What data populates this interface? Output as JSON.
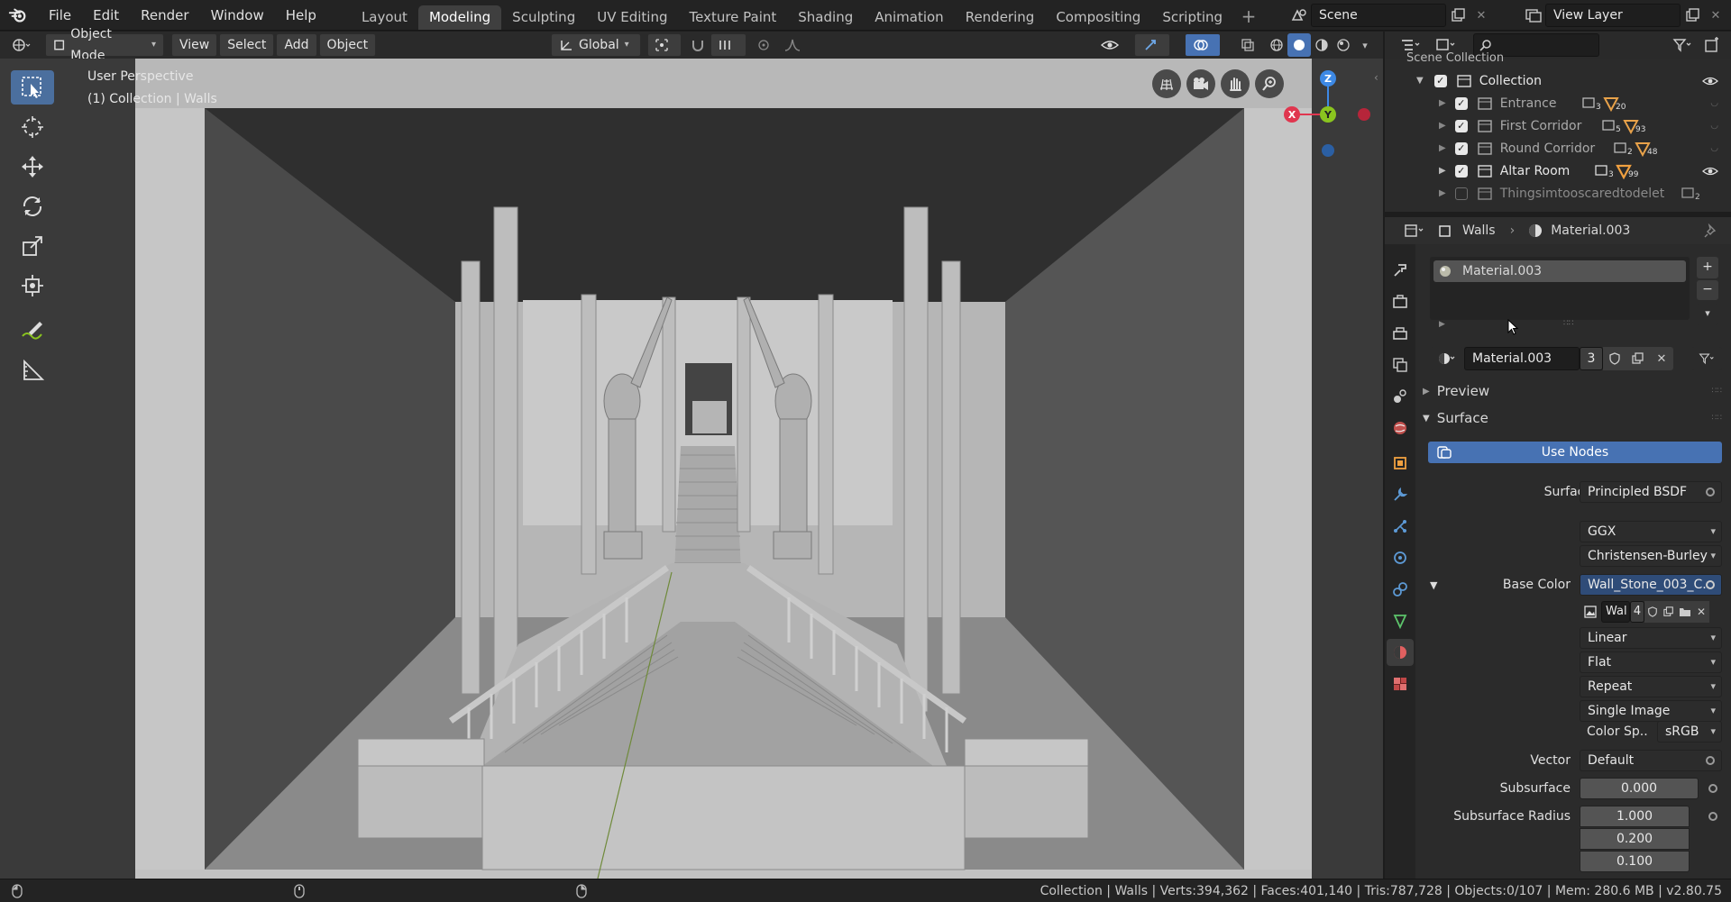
{
  "menu": [
    "File",
    "Edit",
    "Render",
    "Window",
    "Help"
  ],
  "workspaces": [
    {
      "label": "Layout",
      "active": false
    },
    {
      "label": "Modeling",
      "active": true
    },
    {
      "label": "Sculpting",
      "active": false
    },
    {
      "label": "UV Editing",
      "active": false
    },
    {
      "label": "Texture Paint",
      "active": false
    },
    {
      "label": "Shading",
      "active": false
    },
    {
      "label": "Animation",
      "active": false
    },
    {
      "label": "Rendering",
      "active": false
    },
    {
      "label": "Compositing",
      "active": false
    },
    {
      "label": "Scripting",
      "active": false
    }
  ],
  "scene": "Scene",
  "view_layer": "View Layer",
  "viewport_header": {
    "mode": "Object Mode",
    "view": "View",
    "select": "Select",
    "add": "Add",
    "object": "Object",
    "orientation": "Global"
  },
  "viewport": {
    "perspective": "User Perspective",
    "collection_info": "(1) Collection | Walls",
    "axes": {
      "z": "Z",
      "y": "Y",
      "x": "X"
    }
  },
  "outliner": {
    "search_placeholder": "",
    "top_item": "Scene Collection",
    "collection": "Collection",
    "items": [
      {
        "name": "Entrance",
        "count_a": "3",
        "count_b": "20",
        "enabled": true
      },
      {
        "name": "First Corridor",
        "count_a": "5",
        "count_b": "93",
        "enabled": true
      },
      {
        "name": "Round Corridor",
        "count_a": "2",
        "count_b": "48",
        "enabled": true
      },
      {
        "name": "Altar Room",
        "count_a": "3",
        "count_b": "99",
        "enabled": true
      },
      {
        "name": "Thingsimtooscaredtodelet",
        "count_a": "2",
        "count_b": "",
        "enabled": false
      }
    ]
  },
  "properties": {
    "breadcrumb_object": "Walls",
    "breadcrumb_material": "Material.003",
    "slot_name": "Material.003",
    "material_name": "Material.003",
    "material_users": "3",
    "preview": "Preview",
    "surface_section": "Surface",
    "use_nodes": "Use Nodes",
    "surface_label": "Surface",
    "surface_value": "Principled BSDF",
    "distribution": "GGX",
    "subsurface_method": "Christensen-Burley",
    "base_color_label": "Base Color",
    "base_color_value": "Wall_Stone_003_C..",
    "image_name": "Wal",
    "image_users": "4",
    "interpolation": "Linear",
    "projection": "Flat",
    "extension": "Repeat",
    "source": "Single Image",
    "color_space_label": "Color Sp..",
    "color_space_value": "sRGB",
    "vector_label": "Vector",
    "vector_value": "Default",
    "subsurface_label": "Subsurface",
    "subsurface_value": "0.000",
    "subsurface_radius_label": "Subsurface Radius",
    "subsurface_radius": [
      "1.000",
      "0.200",
      "0.100"
    ]
  },
  "status": "Collection | Walls | Verts:394,362 | Faces:401,140 | Tris:787,728 | Objects:0/107 | Mem: 280.6 MB | v2.80.75",
  "colors": {
    "active_tool": "#4b6f9e",
    "use_nodes": "#4772b3",
    "axis_x": "#e0364f",
    "axis_y": "#8ac41f",
    "axis_z": "#3d89e5",
    "selection": "#4772b3"
  }
}
